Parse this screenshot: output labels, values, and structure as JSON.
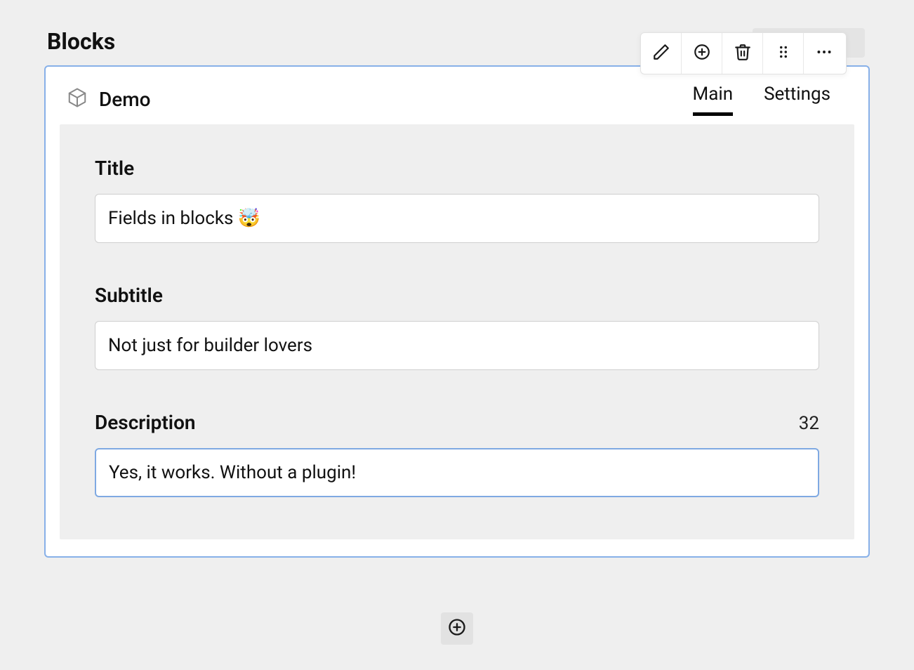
{
  "page": {
    "title": "Blocks"
  },
  "block": {
    "name": "Demo",
    "tabs": [
      {
        "label": "Main",
        "active": true
      },
      {
        "label": "Settings",
        "active": false
      }
    ],
    "fields": {
      "title": {
        "label": "Title",
        "value": "Fields in blocks 🤯"
      },
      "subtitle": {
        "label": "Subtitle",
        "value": "Not just for builder lovers"
      },
      "description": {
        "label": "Description",
        "value": "Yes, it works. Without a plugin!",
        "char_count": "32"
      }
    }
  }
}
